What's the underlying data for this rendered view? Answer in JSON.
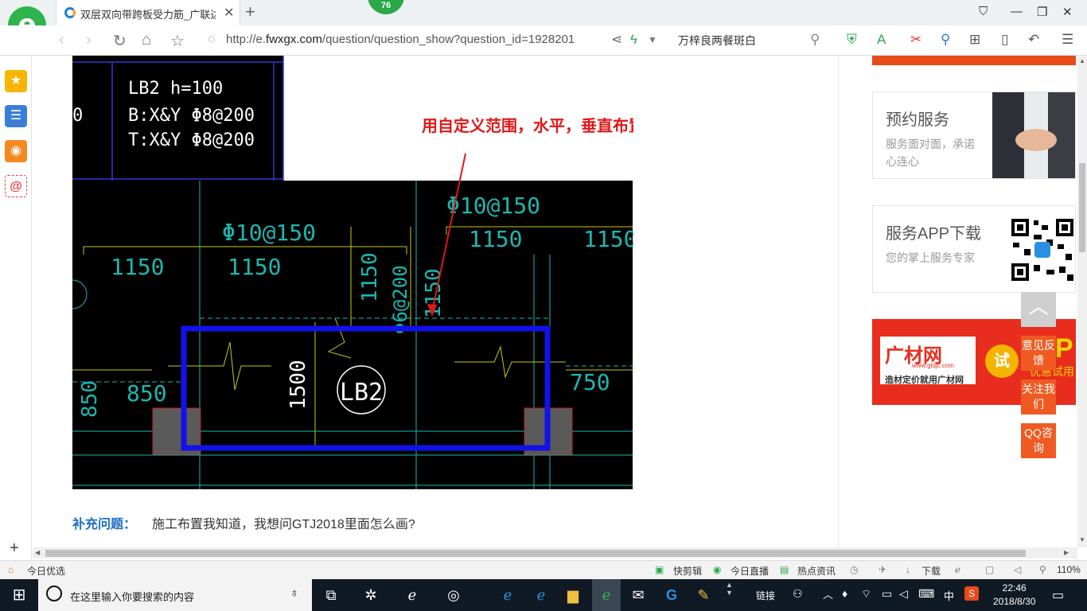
{
  "tab": {
    "title": "双层双向带跨板受力筋_广联达服",
    "close": "✕",
    "new": "+"
  },
  "badge": "76",
  "address": {
    "scheme": "http://e.",
    "host": "fwxgx.com",
    "path": "/question/question_show?question_id=1928201"
  },
  "search": {
    "text": "万梓良两餐斑白"
  },
  "window_buttons": {
    "minimize": "—",
    "restore": "❐",
    "close": "✕"
  },
  "drawing": {
    "annotation": "用自定义范围，水平，垂直布置",
    "legend_line1": "LB2 h=100",
    "legend_line2": "B:X&Y Φ8@200",
    "legend_line3": "T:X&Y Φ8@200",
    "rebar_a": "Φ10@150",
    "rebar_b": "Φ10@150",
    "rebar_c": "Φ6@200",
    "dim_1150_a": "1150",
    "dim_1150_b": "1150",
    "dim_1150_c": "1150",
    "dim_1150_d": "1150",
    "dim_1150_v1": "1150",
    "dim_1150_v2": "1150",
    "dim_850": "850",
    "dim_850_v": "850",
    "dim_750": "750",
    "dim_1500": "1500",
    "slab_tag": "LB2",
    "left_fragment": "0"
  },
  "supplement": {
    "label": "补充问题：",
    "text": "施工布置我知道，我想问GTJ2018里面怎么画?"
  },
  "sidebar": {
    "service_title": "预约服务",
    "service_desc": "服务面对面，承诺心连心",
    "app_title": "服务APP下载",
    "app_desc": "您的掌上服务专家",
    "ad_brand": "广材网",
    "ad_url": "www.gldjc.com",
    "ad_slogan": "造材定价就用广材网",
    "ad_try": "试",
    "ad_p": "P",
    "ad_offer": "优惠试用",
    "feedback": "意见反馈",
    "follow": "关注我们",
    "qq": "QQ咨询",
    "top": "︿"
  },
  "status": {
    "left": "今日优选",
    "kuaijianji": "快剪辑",
    "live": "今日直播",
    "news": "热点资讯",
    "download": "下载",
    "zoom": "110%"
  },
  "taskbar": {
    "search_placeholder": "在这里输入你要搜索的内容",
    "network": "链接",
    "ime": "中",
    "time": "22:46",
    "date": "2018/8/30"
  }
}
